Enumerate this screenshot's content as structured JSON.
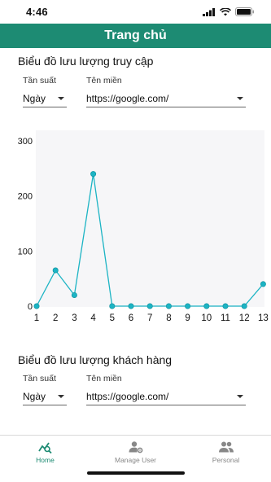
{
  "status": {
    "time": "4:46"
  },
  "app_bar": {
    "title": "Trang chủ"
  },
  "sections": [
    {
      "title": "Biểu đồ lưu lượng truy cập",
      "frequency_label": "Tần suất",
      "frequency_value": "Ngày",
      "domain_label": "Tên miền",
      "domain_value": "https://google.com/"
    },
    {
      "title": "Biểu đồ lưu lượng khách hàng",
      "frequency_label": "Tần suất",
      "frequency_value": "Ngày",
      "domain_label": "Tên miền",
      "domain_value": "https://google.com/"
    }
  ],
  "chart_data": {
    "type": "line",
    "x": [
      1,
      2,
      3,
      4,
      5,
      6,
      7,
      8,
      9,
      10,
      11,
      12,
      13
    ],
    "values": [
      0,
      65,
      20,
      240,
      0,
      0,
      0,
      0,
      0,
      0,
      0,
      0,
      40
    ],
    "y_ticks": [
      "0",
      "100",
      "200",
      "300"
    ],
    "x_ticks": [
      "1",
      "2",
      "3",
      "4",
      "5",
      "6",
      "7",
      "8",
      "9",
      "10",
      "11",
      "12",
      "13"
    ],
    "ylim": [
      0,
      300
    ],
    "grid": false,
    "color": "#1cb4c4"
  },
  "bottom_nav": [
    {
      "label": "Home",
      "icon": "chart-search-icon",
      "active": true
    },
    {
      "label": "Manage User",
      "icon": "manage-user-icon",
      "active": false
    },
    {
      "label": "Personal",
      "icon": "people-icon",
      "active": false
    }
  ],
  "colors": {
    "primary": "#1d8b73",
    "chart_line": "#1cb4c4"
  }
}
